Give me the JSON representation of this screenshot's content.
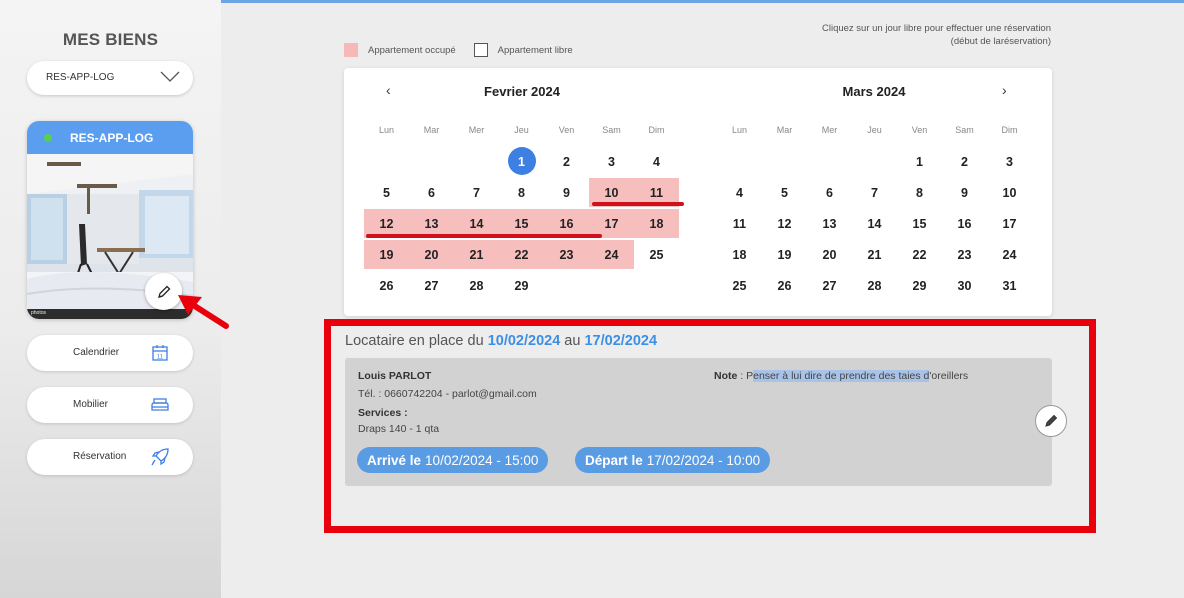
{
  "sidebar": {
    "title": "MES BIENS",
    "select_value": "RES-APP-LOG",
    "property": {
      "name": "RES-APP-LOG",
      "status_color": "#57d14b",
      "photo_caption": "photos"
    },
    "buttons": [
      {
        "label": "Calendrier",
        "icon": "calendar-icon"
      },
      {
        "label": "Mobilier",
        "icon": "bed-icon"
      },
      {
        "label": "Réservation",
        "icon": "rocket-icon"
      }
    ]
  },
  "hint": {
    "line1": "Cliquez sur un jour libre pour effectuer une réservation",
    "line2": "(début de laréservation)"
  },
  "legend": {
    "occupied": "Appartement occupé",
    "free": "Appartement libre",
    "occupied_color": "#f7b8b8"
  },
  "calendar": {
    "weekdays": [
      "Lun",
      "Mar",
      "Mer",
      "Jeu",
      "Ven",
      "Sam",
      "Dim"
    ],
    "months": [
      {
        "title": "Fevrier 2024",
        "first_weekday": 3,
        "days": 29,
        "today": 1,
        "weeks": [
          [
            "",
            "",
            "",
            "1",
            "2",
            "3",
            "4"
          ],
          [
            "5",
            "6",
            "7",
            "8",
            "9",
            "10",
            "11"
          ],
          [
            "12",
            "13",
            "14",
            "15",
            "16",
            "17",
            "18"
          ],
          [
            "19",
            "20",
            "21",
            "22",
            "23",
            "24",
            "25"
          ],
          [
            "26",
            "27",
            "28",
            "29",
            "",
            "",
            ""
          ]
        ]
      },
      {
        "title": "Mars 2024",
        "first_weekday": 4,
        "days": 31,
        "weeks": [
          [
            "",
            "",
            "",
            "",
            "1",
            "2",
            "3"
          ],
          [
            "4",
            "5",
            "6",
            "7",
            "8",
            "9",
            "10"
          ],
          [
            "11",
            "12",
            "13",
            "14",
            "15",
            "16",
            "17"
          ],
          [
            "18",
            "19",
            "20",
            "21",
            "22",
            "23",
            "24"
          ],
          [
            "25",
            "26",
            "27",
            "28",
            "29",
            "30",
            "31"
          ]
        ]
      }
    ],
    "prev": "‹",
    "next": "›"
  },
  "tenant": {
    "prefix": "Locataire en place du",
    "from": "10/02/2024",
    "mid": "au",
    "to": "17/02/2024",
    "name": "Louis PARLOT",
    "tel": "Tél. : 0660742204 - parlot@gmail.com",
    "services_label": "Services :",
    "services": "Draps 140 - 1 qta",
    "note_label": "Note",
    "note_sep": " : ",
    "note_a": "P",
    "note_b": "enser à lui dire de prendre des taies d",
    "note_c": "'oreillers",
    "arrive_label": "Arrivé le",
    "arrive_value": "10/02/2024 - 15:00",
    "depart_label": "Départ le",
    "depart_value": "17/02/2024 - 10:00"
  }
}
